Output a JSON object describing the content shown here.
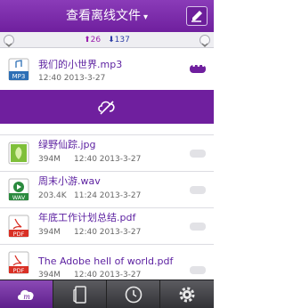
{
  "header": {
    "title": "查看离线文件",
    "caret": "▾"
  },
  "sortbar": {
    "up_count": "26",
    "down_count": "137"
  },
  "files": [
    {
      "name": "我们的小世界.mp3",
      "size": "",
      "time": "12:40 2013-3-27",
      "icon_type": "MP3",
      "selected": true
    },
    {
      "name": "绿野仙踪.jpg",
      "size": "394M",
      "time": "12:40 2013-3-27",
      "icon_type": "image",
      "selected": false
    },
    {
      "name": "周末小游.wav",
      "size": "203.4K",
      "time": "11:24 2013-3-27",
      "icon_type": "WAV",
      "selected": false
    },
    {
      "name": "年底工作计划总结.pdf",
      "size": "394M",
      "time": "12:40 2013-3-27",
      "icon_type": "PDF",
      "selected": false
    },
    {
      "name": "The Adobe hell of world.pdf",
      "size": "394M",
      "time": "12:40 2013-3-27",
      "icon_type": "PDF",
      "selected": false
    }
  ],
  "icons": {
    "edit": "pencil-icon",
    "action": "cloud-off-icon",
    "tabs": [
      "cloud-logo-icon",
      "phone-icon",
      "clock-icon",
      "gear-icon"
    ]
  },
  "colors": {
    "accent": "#6f1f9e",
    "tab_bar": "#3a3a3f"
  }
}
